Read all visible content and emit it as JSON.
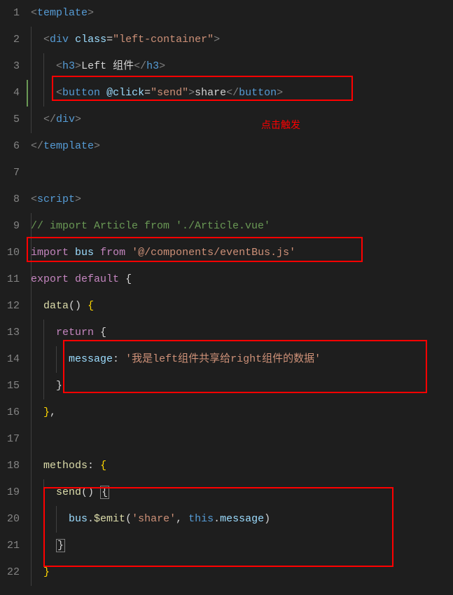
{
  "lineNumbers": [
    "1",
    "2",
    "3",
    "4",
    "5",
    "6",
    "7",
    "8",
    "9",
    "10",
    "11",
    "12",
    "13",
    "14",
    "15",
    "16",
    "17",
    "18",
    "19",
    "20",
    "21",
    "22"
  ],
  "code": {
    "l1": {
      "a": "<",
      "b": "template",
      "c": ">"
    },
    "l2": {
      "a": "<",
      "b": "div",
      "sp": " ",
      "c": "class",
      "d": "=",
      "e": "\"left-container\"",
      "f": ">"
    },
    "l3": {
      "a": "<",
      "b": "h3",
      "c": ">",
      "d": "Left 组件",
      "e": "</",
      "f": "h3",
      "g": ">"
    },
    "l4": {
      "a": "<",
      "b": "button",
      "sp": " ",
      "c": "@click",
      "d": "=",
      "e": "\"send\"",
      "f": ">",
      "g": "share",
      "h": "</",
      "i": "button",
      "j": ">"
    },
    "l5": {
      "a": "</",
      "b": "div",
      "c": ">"
    },
    "l6": {
      "a": "</",
      "b": "template",
      "c": ">"
    },
    "l8": {
      "a": "<",
      "b": "script",
      "c": ">"
    },
    "l9": {
      "a": "// import Article from './Article.vue'"
    },
    "l10": {
      "a": "import",
      "sp": " ",
      "b": "bus",
      "sp2": " ",
      "c": "from",
      "sp3": " ",
      "d": "'@/components/eventBus.js'"
    },
    "l11": {
      "a": "export",
      "sp": " ",
      "b": "default",
      "sp2": " ",
      "c": "{"
    },
    "l12": {
      "a": "data",
      "b": "()",
      "sp": " ",
      "c": "{"
    },
    "l13": {
      "a": "return",
      "sp": " ",
      "b": "{"
    },
    "l14": {
      "a": "message",
      "b": ":",
      "sp": " ",
      "c": "'我是left组件共享给right组件的数据'"
    },
    "l15": {
      "a": "}"
    },
    "l16": {
      "a": "}",
      "b": ","
    },
    "l18": {
      "a": "methods",
      "b": ":",
      "sp": " ",
      "c": "{"
    },
    "l19": {
      "a": "send",
      "b": "()",
      "sp": " ",
      "c": "{"
    },
    "l20": {
      "a": "bus",
      "b": ".",
      "c": "$emit",
      "d": "(",
      "e": "'share'",
      "f": ",",
      "sp": " ",
      "g": "this",
      "h": ".",
      "i": "message",
      "j": ")"
    },
    "l21": {
      "a": "}"
    },
    "l22": {
      "a": "}"
    }
  },
  "annotation": "点击触发"
}
